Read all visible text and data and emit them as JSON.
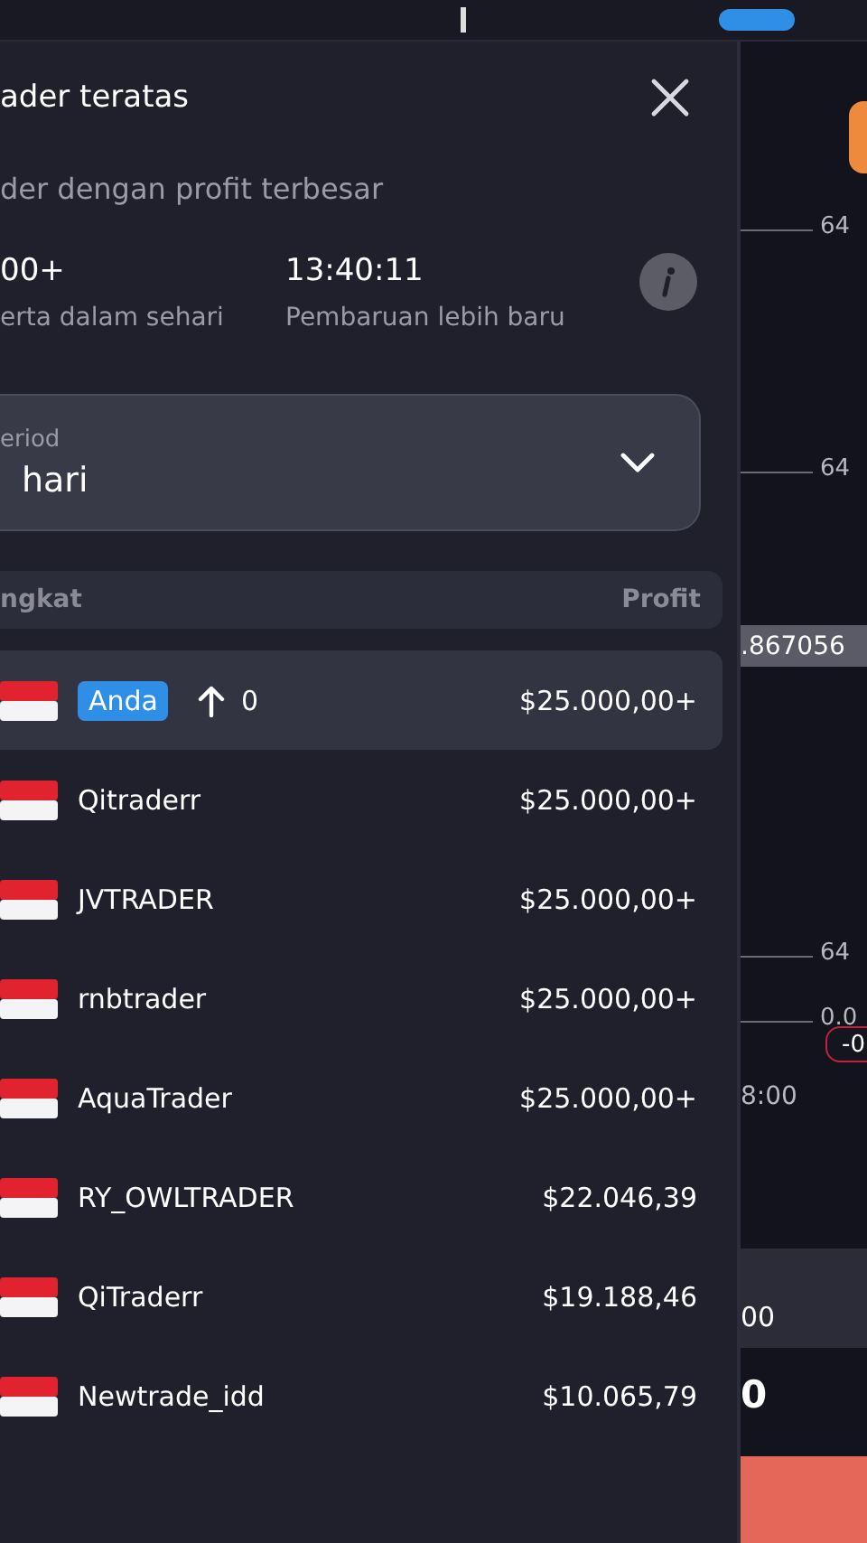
{
  "panel": {
    "title": "ader teratas",
    "subtitle": "der dengan profit terbesar",
    "stats": [
      {
        "value": "00+",
        "label": "erta dalam sehari"
      },
      {
        "value": "13:40:11",
        "label": "Pembaruan lebih baru"
      }
    ],
    "period": {
      "label": "eriod",
      "value": "hari"
    },
    "table": {
      "columns": [
        "ngkat",
        "Profit"
      ],
      "rows": [
        {
          "name": "Anda",
          "kind": "self",
          "change": "0",
          "profit": "$25.000,00+",
          "selected": true
        },
        {
          "name": "Qitraderr",
          "kind": "trader",
          "profit": "$25.000,00+",
          "selected": false
        },
        {
          "name": "JVTRADER",
          "kind": "trader",
          "profit": "$25.000,00+",
          "selected": false
        },
        {
          "name": "rnbtrader",
          "kind": "trader",
          "profit": "$25.000,00+",
          "selected": false
        },
        {
          "name": "AquaTrader",
          "kind": "trader",
          "profit": "$25.000,00+",
          "selected": false
        },
        {
          "name": "RY_OWLTRADER",
          "kind": "trader",
          "profit": "$22.046,39",
          "selected": false
        },
        {
          "name": "QiTraderr",
          "kind": "trader",
          "profit": "$19.188,46",
          "selected": false
        },
        {
          "name": "Newtrade_idd",
          "kind": "trader",
          "profit": "$10.065,79",
          "selected": false
        }
      ]
    }
  },
  "chart": {
    "axis_labels": [
      "64",
      "64",
      "64",
      "0.0"
    ],
    "price_tag": ".867056",
    "trade_badge": "-0",
    "time_label": "8:00",
    "amount": "00",
    "value": "0"
  }
}
